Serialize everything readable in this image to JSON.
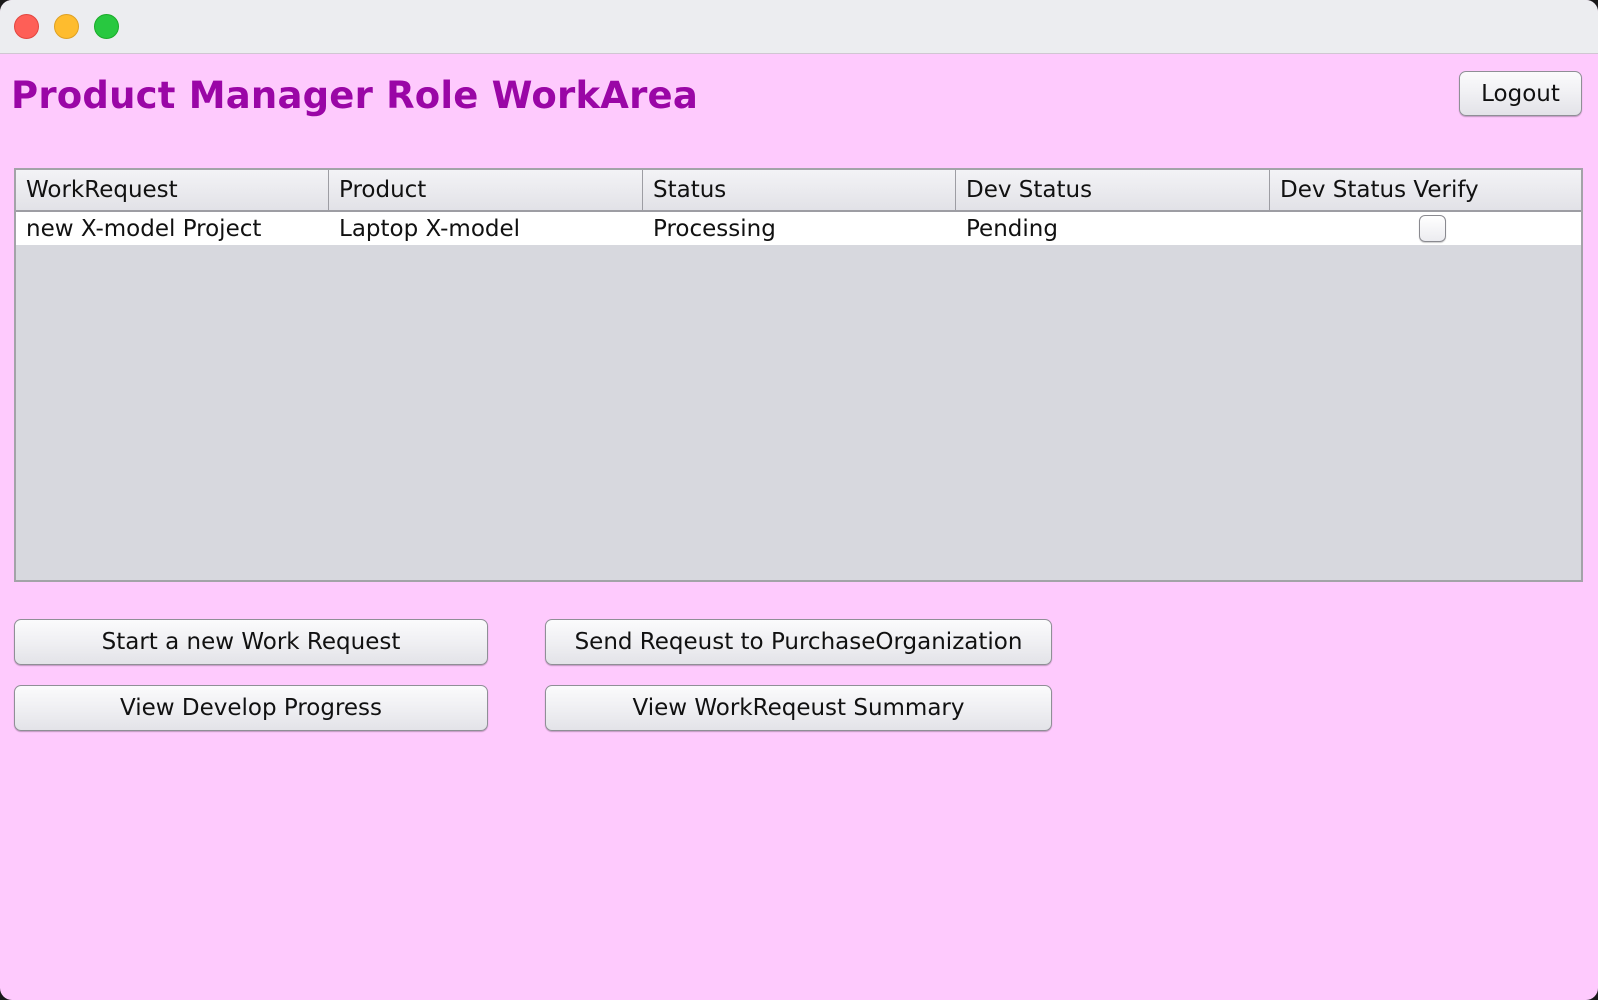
{
  "window": {
    "page_title": "Product Manager Role WorkArea",
    "logout_label": "Logout"
  },
  "table": {
    "columns": [
      "WorkRequest",
      "Product",
      "Status",
      "Dev Status",
      "Dev  Status Verify"
    ],
    "rows": [
      {
        "work_request": "new X-model Project",
        "product": "Laptop X-model",
        "status": "Processing",
        "dev_status": "Pending",
        "dev_status_verify": false
      }
    ]
  },
  "actions": {
    "start_label": "Start a new Work Request",
    "send_label": "Send Reqeust to PurchaseOrganization",
    "view_progress_label": "View Develop Progress",
    "view_summary_label": "View WorkReqeust Summary"
  },
  "colors": {
    "background": "#fecafd",
    "title": "#9a06a6",
    "table_empty_area": "#d7d8de"
  }
}
